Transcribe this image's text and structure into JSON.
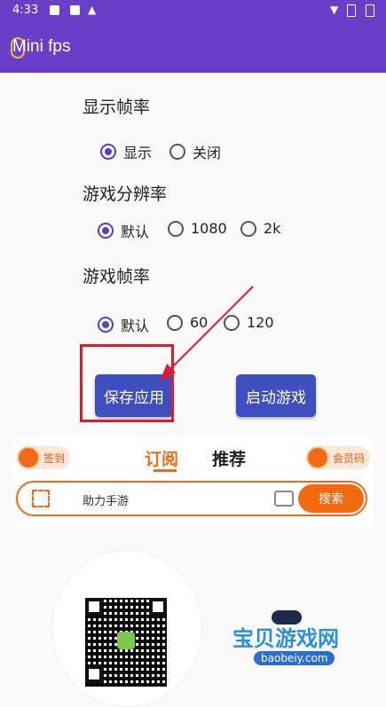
{
  "status": {
    "time": "4:33"
  },
  "app": {
    "title": "Mini fps"
  },
  "display_fps": {
    "label": "显示帧率",
    "options": [
      {
        "label": "显示",
        "checked": true
      },
      {
        "label": "关闭",
        "checked": false
      }
    ]
  },
  "resolution": {
    "label": "游戏分辨率",
    "options": [
      {
        "label": "默认",
        "checked": true
      },
      {
        "label": "1080",
        "checked": false
      },
      {
        "label": "2k",
        "checked": false
      }
    ]
  },
  "game_fps": {
    "label": "游戏帧率",
    "options": [
      {
        "label": "默认",
        "checked": true
      },
      {
        "label": "60",
        "checked": false
      },
      {
        "label": "120",
        "checked": false
      }
    ]
  },
  "buttons": {
    "save": "保存应用",
    "launch": "启动游戏"
  },
  "banner": {
    "signin": "签到",
    "tab_subscribe": "订阅",
    "tab_recommend": "推荐",
    "vip": "会员码",
    "search_text": "助力手游",
    "search_button": "搜索"
  },
  "watermark": {
    "title": "宝贝游戏网",
    "url": "baobeiy.com"
  },
  "colors": {
    "primary": "#6a3fc8",
    "button": "#3f4fbf",
    "accent": "#f06a1a",
    "highlight": "#e01a2a"
  }
}
